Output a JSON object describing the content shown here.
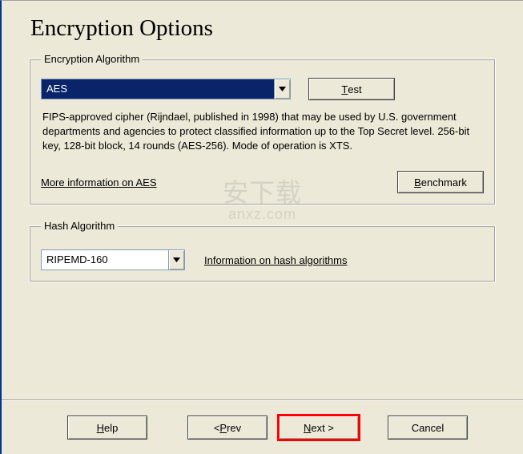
{
  "title": "Encryption Options",
  "encryption": {
    "legend": "Encryption Algorithm",
    "selected": "AES",
    "test_label": "est",
    "test_hotkey": "T",
    "description": "FIPS-approved cipher (Rijndael, published in 1998) that may be used by U.S. government departments and agencies to protect classified information up to the Top Secret level. 256-bit key, 128-bit block, 14 rounds (AES-256). Mode of operation is XTS.",
    "more_info_label": "More information on AES",
    "benchmark_label": "enchmark",
    "benchmark_hotkey": "B"
  },
  "hash": {
    "legend": "Hash Algorithm",
    "selected": "RIPEMD-160",
    "info_label": "Information on hash algorithms"
  },
  "footer": {
    "help_label": "elp",
    "help_hotkey": "H",
    "prev_label": "rev",
    "prev_prefix": "< ",
    "prev_hotkey": "P",
    "next_label": "ext >",
    "next_hotkey": "N",
    "cancel_label": "Cancel"
  },
  "watermark": {
    "top": "安下载",
    "sub": "anxz.com"
  }
}
